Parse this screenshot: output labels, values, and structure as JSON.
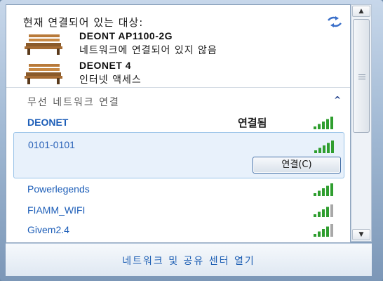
{
  "current": {
    "heading": "현재 연결되어 있는 대상:",
    "items": [
      {
        "name": "DEONT AP1100-2G",
        "status": "네트워크에 연결되어 있지 않음",
        "icon": "bench-network-icon"
      },
      {
        "name": "DEONET  4",
        "status": "인터넷 액세스",
        "icon": "bench-network-icon"
      }
    ]
  },
  "wireless": {
    "heading": "무선 네트워크 연결",
    "networks": [
      {
        "name": "DEONET",
        "state": "연결됨",
        "signal": 5
      },
      {
        "name": "0101-0101",
        "signal": 5,
        "connect_label": "연결(C)"
      },
      {
        "name": "Powerlegends",
        "signal": 5
      },
      {
        "name": "FIAMM_WIFI",
        "signal": 4
      },
      {
        "name": "Givem2.4",
        "signal": 4
      }
    ]
  },
  "footer": {
    "link_label": "네트워크 및 공유 센터 열기"
  },
  "colors": {
    "accent": "#1d5eb8",
    "signal_green": "#2f9e2f",
    "signal_gray": "#a8a8a8"
  }
}
